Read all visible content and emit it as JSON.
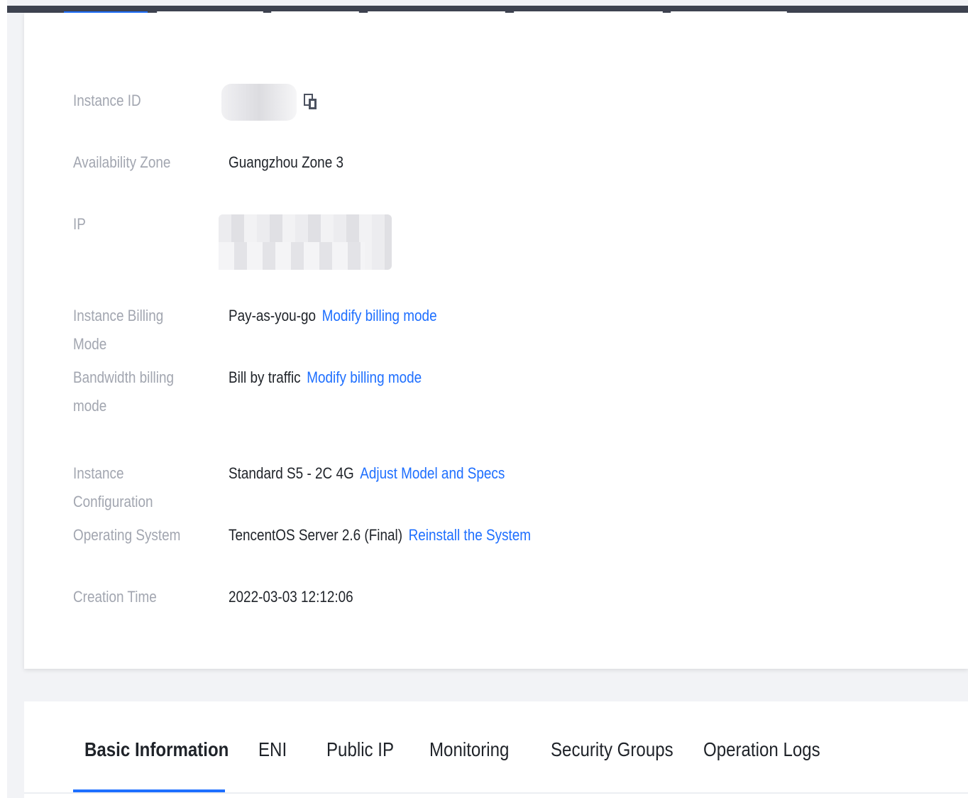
{
  "details": {
    "instance_id": {
      "label": "Instance ID",
      "value_suffix": "              "
    },
    "availability_zone": {
      "label": "Availability Zone",
      "value": "Guangzhou Zone 3"
    },
    "ip": {
      "label": "IP"
    },
    "billing_mode": {
      "label": "Instance Billing Mode",
      "value": "Pay-as-you-go",
      "action": "Modify billing mode"
    },
    "bandwidth_billing": {
      "label_line1": "Bandwidth billing",
      "label_line2": "mode",
      "value": "Bill by traffic",
      "action": "Modify billing mode"
    },
    "configuration": {
      "label": "Instance Configuration",
      "value": "Standard S5 - 2C 4G",
      "action": "Adjust Model and Specs"
    },
    "os": {
      "label": "Operating System",
      "value": "TencentOS Server 2.6 (Final)",
      "action": "Reinstall the System"
    },
    "creation_time": {
      "label": "Creation Time",
      "value": "2022-03-03 12:12:06"
    }
  },
  "tabs": [
    {
      "label": "Basic Information",
      "active": true
    },
    {
      "label": "ENI"
    },
    {
      "label": "Public IP"
    },
    {
      "label": "Monitoring"
    },
    {
      "label": "Security Groups"
    },
    {
      "label": "Operation Logs"
    }
  ],
  "icons": {
    "copy": "copy-icon"
  },
  "colors": {
    "accent": "#1e6fff",
    "label": "#a2a6b0",
    "text": "#1f2329",
    "header_bar": "#3e4350"
  }
}
